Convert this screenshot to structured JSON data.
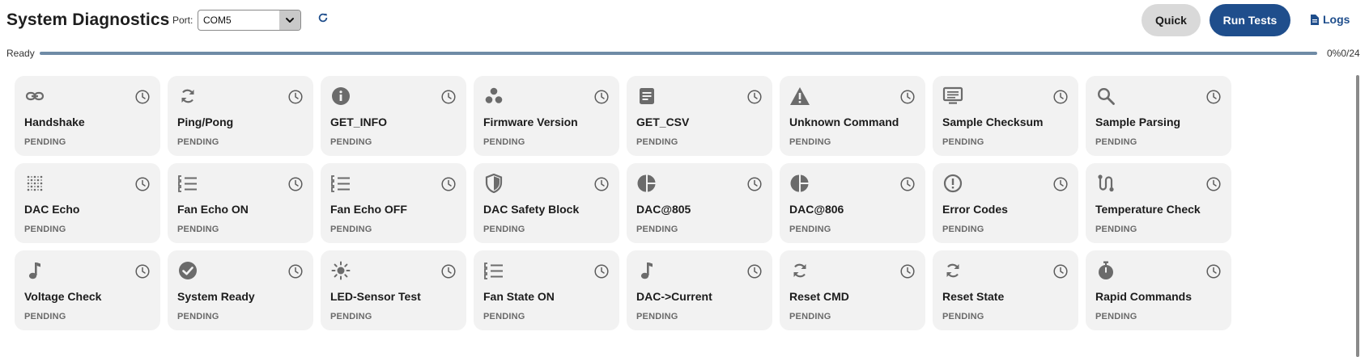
{
  "app": {
    "title": "System Diagnostics",
    "port_label": "Port:",
    "port_value": "COM5",
    "quick_label": "Quick",
    "run_label": "Run Tests",
    "logs_label": "Logs"
  },
  "status": {
    "text": "Ready",
    "progress_fraction": 0,
    "percent_text": "0%",
    "count_text": "0/24"
  },
  "colors": {
    "accent": "#1f4e8c",
    "card_bg": "#f2f2f2",
    "icon": "#6b6b6b"
  },
  "tests": [
    {
      "name": "Handshake",
      "status": "PENDING",
      "icon": "link-icon"
    },
    {
      "name": "Ping/Pong",
      "status": "PENDING",
      "icon": "sync-icon"
    },
    {
      "name": "GET_INFO",
      "status": "PENDING",
      "icon": "info-icon"
    },
    {
      "name": "Firmware Version",
      "status": "PENDING",
      "icon": "bubbles-icon"
    },
    {
      "name": "GET_CSV",
      "status": "PENDING",
      "icon": "document-icon"
    },
    {
      "name": "Unknown Command",
      "status": "PENDING",
      "icon": "warning-icon"
    },
    {
      "name": "Sample Checksum",
      "status": "PENDING",
      "icon": "monitor-icon"
    },
    {
      "name": "Sample Parsing",
      "status": "PENDING",
      "icon": "search-icon"
    },
    {
      "name": "DAC Echo",
      "status": "PENDING",
      "icon": "dot-grid-icon"
    },
    {
      "name": "Fan Echo ON",
      "status": "PENDING",
      "icon": "checklist-icon"
    },
    {
      "name": "Fan Echo OFF",
      "status": "PENDING",
      "icon": "checklist-icon"
    },
    {
      "name": "DAC Safety Block",
      "status": "PENDING",
      "icon": "shield-icon"
    },
    {
      "name": "DAC@805",
      "status": "PENDING",
      "icon": "pie-chart-icon"
    },
    {
      "name": "DAC@806",
      "status": "PENDING",
      "icon": "pie-chart-icon"
    },
    {
      "name": "Error Codes",
      "status": "PENDING",
      "icon": "alert-circle-icon"
    },
    {
      "name": "Temperature Check",
      "status": "PENDING",
      "icon": "route-icon"
    },
    {
      "name": "Voltage Check",
      "status": "PENDING",
      "icon": "music-note-icon"
    },
    {
      "name": "System Ready",
      "status": "PENDING",
      "icon": "check-circle-icon"
    },
    {
      "name": "LED-Sensor Test",
      "status": "PENDING",
      "icon": "sun-icon"
    },
    {
      "name": "Fan State ON",
      "status": "PENDING",
      "icon": "checklist-icon"
    },
    {
      "name": "DAC->Current",
      "status": "PENDING",
      "icon": "music-note-icon"
    },
    {
      "name": "Reset CMD",
      "status": "PENDING",
      "icon": "sync-icon"
    },
    {
      "name": "Reset State",
      "status": "PENDING",
      "icon": "sync-icon"
    },
    {
      "name": "Rapid Commands",
      "status": "PENDING",
      "icon": "stopwatch-icon"
    }
  ]
}
